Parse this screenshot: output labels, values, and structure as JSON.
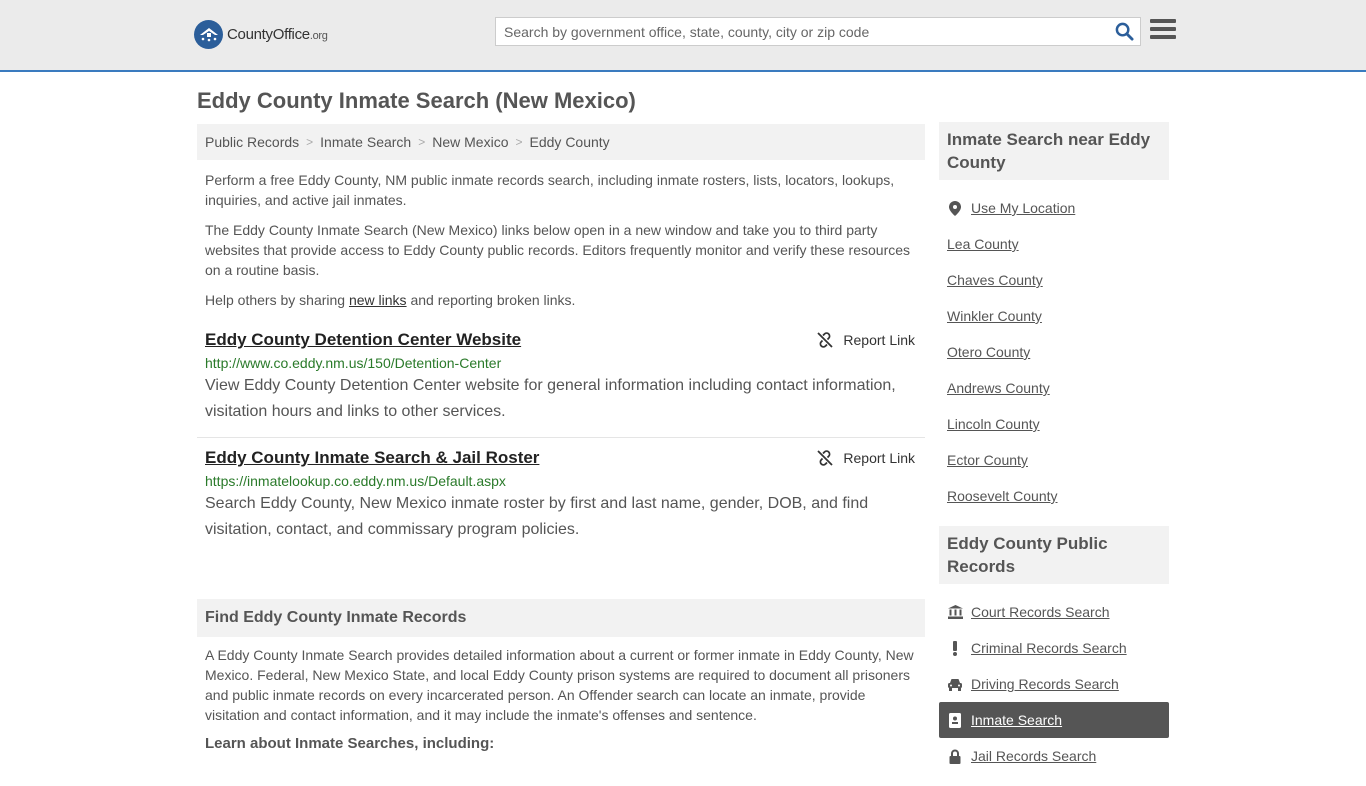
{
  "header": {
    "logo_name": "CountyOffice",
    "logo_suffix": ".org",
    "search_placeholder": "Search by government office, state, county, city or zip code"
  },
  "page_title": "Eddy County Inmate Search (New Mexico)",
  "breadcrumb": [
    "Public Records",
    "Inmate Search",
    "New Mexico",
    "Eddy County"
  ],
  "intro": {
    "p1": "Perform a free Eddy County, NM public inmate records search, including inmate rosters, lists, locators, lookups, inquiries, and active jail inmates.",
    "p2": "The Eddy County Inmate Search (New Mexico) links below open in a new window and take you to third party websites that provide access to Eddy County public records. Editors frequently monitor and verify these resources on a routine basis.",
    "p3_before": "Help others by sharing ",
    "p3_link": "new links",
    "p3_after": " and reporting broken links."
  },
  "results": [
    {
      "title": "Eddy County Detention Center Website",
      "url": "http://www.co.eddy.nm.us/150/Detention-Center",
      "desc": "View Eddy County Detention Center website for general information including contact information, visitation hours and links to other services.",
      "report_label": "Report Link"
    },
    {
      "title": "Eddy County Inmate Search & Jail Roster",
      "url": "https://inmatelookup.co.eddy.nm.us/Default.aspx",
      "desc": "Search Eddy County, New Mexico inmate roster by first and last name, gender, DOB, and find visitation, contact, and commissary program policies.",
      "report_label": "Report Link"
    }
  ],
  "find_section": {
    "heading": "Find Eddy County Inmate Records",
    "text": "A Eddy County Inmate Search provides detailed information about a current or former inmate in Eddy County, New Mexico. Federal, New Mexico State, and local Eddy County prison systems are required to document all prisoners and public inmate records on every incarcerated person. An Offender search can locate an inmate, provide visitation and contact information, and it may include the inmate's offenses and sentence.",
    "learn": "Learn about Inmate Searches, including:"
  },
  "sidebar": {
    "nearby_heading": "Inmate Search near Eddy County",
    "nearby": [
      {
        "label": "Use My Location",
        "icon": "map-marker-icon"
      },
      {
        "label": "Lea County"
      },
      {
        "label": "Chaves County"
      },
      {
        "label": "Winkler County"
      },
      {
        "label": "Otero County"
      },
      {
        "label": "Andrews County"
      },
      {
        "label": "Lincoln County"
      },
      {
        "label": "Ector County"
      },
      {
        "label": "Roosevelt County"
      }
    ],
    "records_heading": "Eddy County Public Records",
    "records": [
      {
        "label": "Court Records Search",
        "icon": "courthouse-icon"
      },
      {
        "label": "Criminal Records Search",
        "icon": "exclamation-icon"
      },
      {
        "label": "Driving Records Search",
        "icon": "car-icon"
      },
      {
        "label": "Inmate Search",
        "icon": "id-badge-icon",
        "active": true
      },
      {
        "label": "Jail Records Search",
        "icon": "lock-icon"
      }
    ]
  }
}
